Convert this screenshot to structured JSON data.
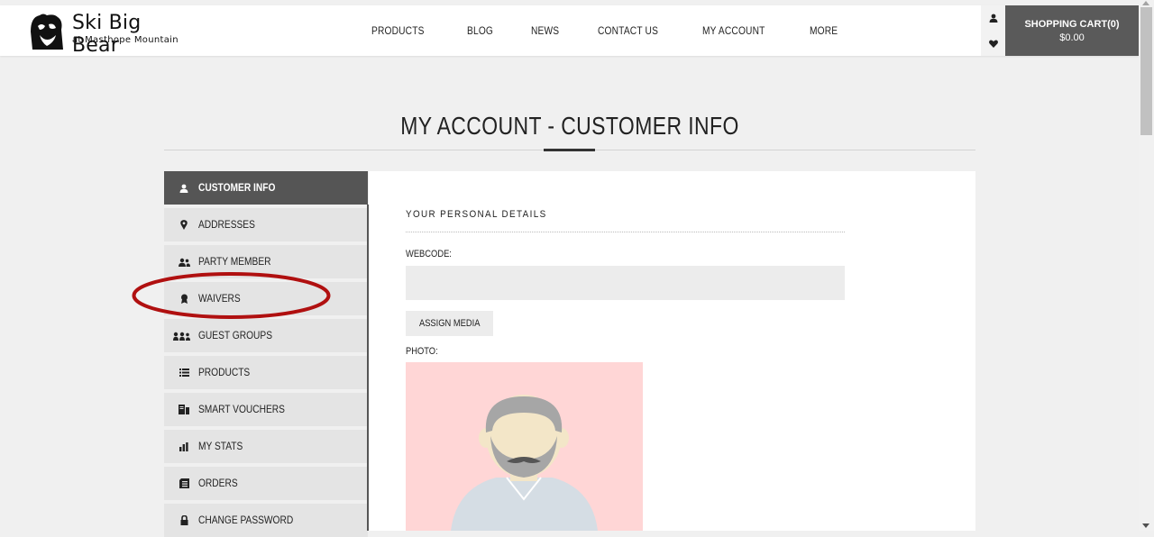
{
  "header": {
    "logo": {
      "name": "Ski Big Bear",
      "sub": "at Masthope Mountain"
    },
    "nav": [
      "PRODUCTS",
      "BLOG",
      "NEWS",
      "CONTACT US",
      "MY ACCOUNT",
      "MORE"
    ],
    "cart": {
      "label": "SHOPPING CART(0)",
      "total": "$0.00"
    },
    "icons": [
      "user-icon",
      "heart-icon"
    ]
  },
  "page": {
    "title": "MY ACCOUNT - CUSTOMER INFO"
  },
  "sidebar": {
    "items": [
      {
        "label": "CUSTOMER INFO",
        "icon": "user-icon",
        "active": true
      },
      {
        "label": "ADDRESSES",
        "icon": "map-pin-icon"
      },
      {
        "label": "PARTY MEMBER",
        "icon": "users-icon"
      },
      {
        "label": "WAIVERS",
        "icon": "ribbon-icon"
      },
      {
        "label": "GUEST GROUPS",
        "icon": "group-icon"
      },
      {
        "label": "PRODUCTS",
        "icon": "list-icon"
      },
      {
        "label": "SMART VOUCHERS",
        "icon": "voucher-icon"
      },
      {
        "label": "MY STATS",
        "icon": "bar-chart-icon"
      },
      {
        "label": "ORDERS",
        "icon": "orders-icon"
      },
      {
        "label": "CHANGE PASSWORD",
        "icon": "lock-icon"
      }
    ]
  },
  "details": {
    "section_title": "YOUR PERSONAL DETAILS",
    "webcode_label": "WEBCODE:",
    "webcode_value": "",
    "assign_label": "ASSIGN MEDIA",
    "photo_label": "PHOTO:"
  },
  "colors": {
    "active_bg": "#555555",
    "cart_bg": "#5a5a5a",
    "annotation": "#b01010",
    "photo_bg": "#ffd6d6"
  }
}
